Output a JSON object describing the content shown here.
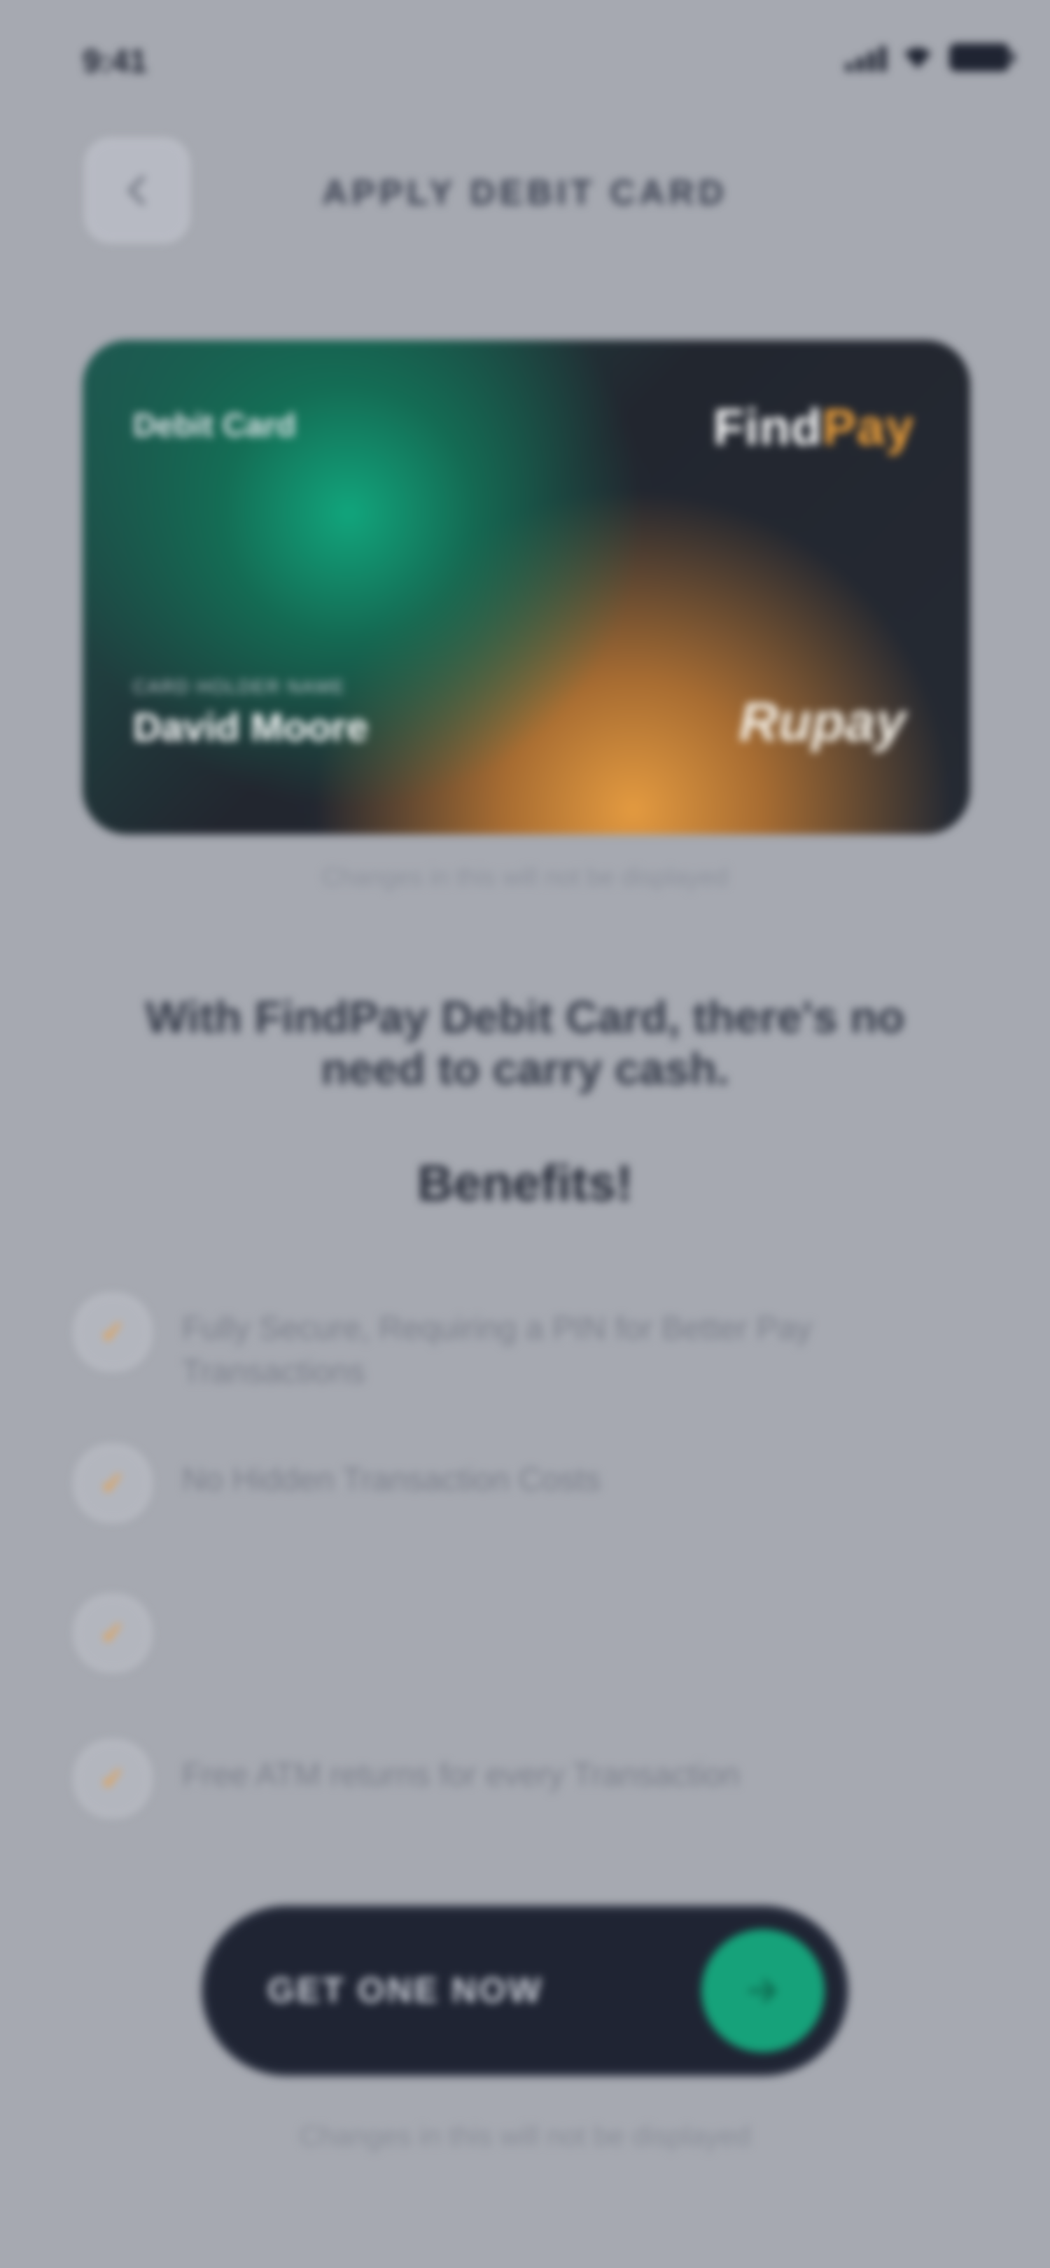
{
  "status_bar": {
    "time": "9:41"
  },
  "header": {
    "back_icon": "back-arrow-icon",
    "title": "APPLY DEBIT CARD"
  },
  "card": {
    "label": "Debit Card",
    "brand_main": "Find",
    "brand_accent": "Pay",
    "holder_caption": "CARD HOLDER NAME",
    "holder_name": "David Moore",
    "network": "Rupay",
    "note": "Changes in this will not be displayed"
  },
  "tagline": "With FindPay Debit Card, there's no need to carry cash.",
  "benefits": {
    "title": "Benefits!",
    "items": [
      {
        "icon": "benefit-check-icon",
        "text": "Fully Secure, Requiring a PIN for Better Pay Transactions"
      },
      {
        "icon": "benefit-check-icon",
        "text": "No Hidden Transaction Costs"
      },
      {
        "icon": "benefit-check-icon",
        "text": ""
      },
      {
        "icon": "benefit-check-icon",
        "text": "Free ATM returns for every Transaction"
      }
    ]
  },
  "cta": {
    "label": "GET ONE NOW",
    "arrow_icon": "arrow-right-icon"
  },
  "footer_note": "Changes in this will not be displayed",
  "colors": {
    "background": "#a6a9b1",
    "card_green": "#11a57c",
    "card_orange": "#e39a40",
    "cta_bg": "#1f2433",
    "cta_accent": "#16a27a"
  }
}
